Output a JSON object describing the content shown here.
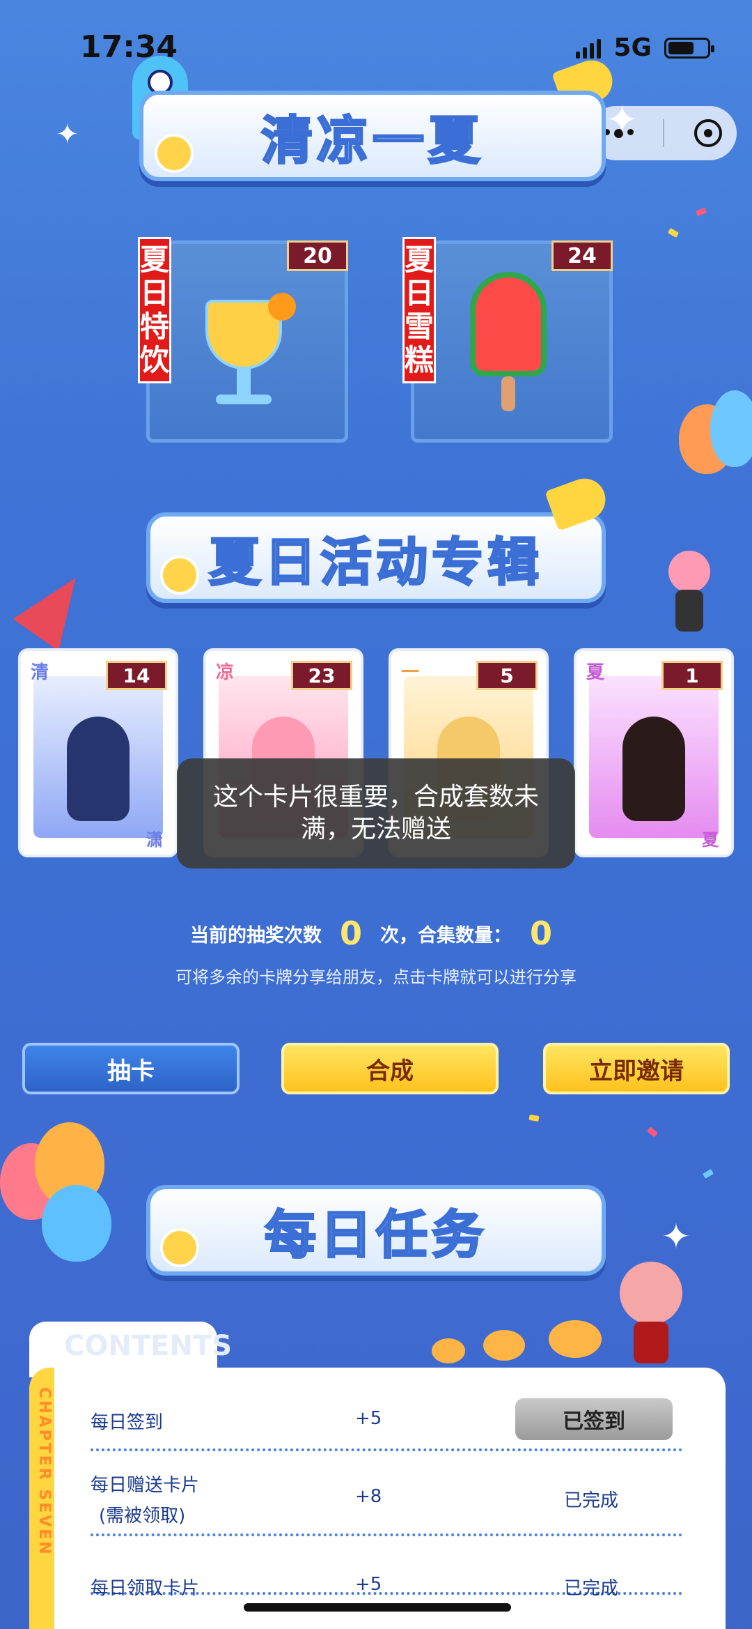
{
  "status_bar": {
    "time": "17:34",
    "network": "5G"
  },
  "banners": {
    "top": "清凉一夏",
    "middle": "夏日活动专辑",
    "tasks": "每日任务"
  },
  "products": [
    {
      "ribbon": "夏日特饮",
      "count": "20"
    },
    {
      "ribbon": "夏日雪糕",
      "count": "24"
    }
  ],
  "cards": [
    {
      "char": "清",
      "count": "14",
      "corner": "潇"
    },
    {
      "char": "凉",
      "count": "23",
      "corner": ""
    },
    {
      "char": "一",
      "count": "5",
      "corner": ""
    },
    {
      "char": "夏",
      "count": "1",
      "corner": "夏"
    }
  ],
  "toast": "这个卡片很重要，合成套数未满，无法赠送",
  "draws": {
    "label": "当前的抽奖次数",
    "count": "0",
    "unit_collect": "次，合集数量：",
    "collect_count": "0",
    "tip": "可将多余的卡牌分享给朋友，点击卡牌就可以进行分享"
  },
  "buttons": {
    "draw": "抽卡",
    "combine": "合成",
    "invite": "立即邀请"
  },
  "panel": {
    "tab_watermark": "CONTENTS",
    "side_label": "CHAPTER SEVEN"
  },
  "tasks": [
    {
      "name": "每日签到",
      "points": "+5",
      "status": "已签到"
    },
    {
      "name": "每日赠送卡片",
      "note": "(需被领取)",
      "points": "+8",
      "status": "已完成"
    },
    {
      "name": "每日领取卡片",
      "points": "+5",
      "status": "已完成"
    }
  ],
  "colors": {
    "accent_yellow": "#ffc21f",
    "banner_text": "#8cbaf3",
    "count_bg": "#7a1a2a"
  }
}
